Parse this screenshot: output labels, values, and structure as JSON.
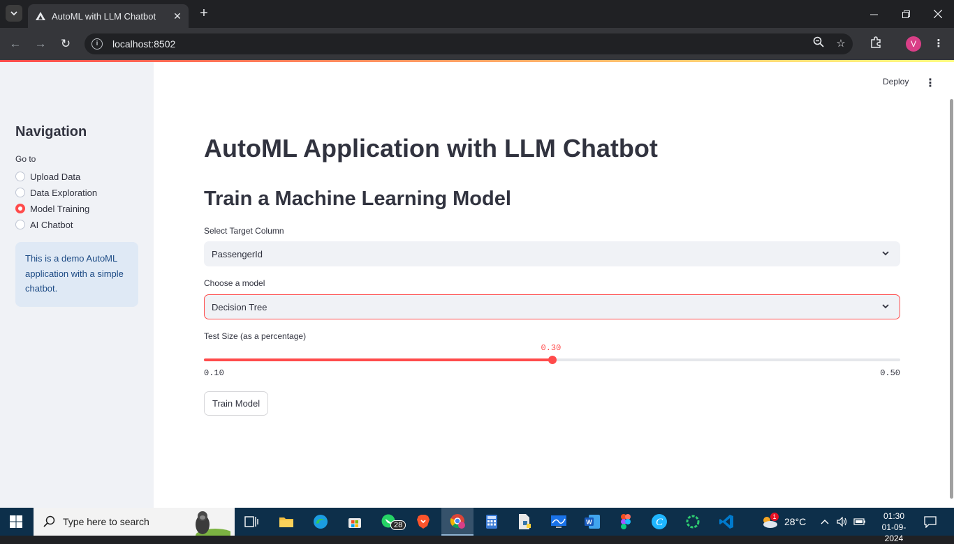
{
  "browser": {
    "tab_title": "AutoML with LLM Chatbot",
    "url": "localhost:8502",
    "profile_initial": "V"
  },
  "app": {
    "deploy_label": "Deploy",
    "sidebar": {
      "title": "Navigation",
      "goto_label": "Go to",
      "options": [
        {
          "label": "Upload Data",
          "checked": false
        },
        {
          "label": "Data Exploration",
          "checked": false
        },
        {
          "label": "Model Training",
          "checked": true
        },
        {
          "label": "AI Chatbot",
          "checked": false
        }
      ],
      "info": "This is a demo AutoML application with a simple chatbot."
    },
    "main": {
      "title": "AutoML Application with LLM Chatbot",
      "subtitle": "Train a Machine Learning Model",
      "target_label": "Select Target Column",
      "target_value": "PassengerId",
      "model_label": "Choose a model",
      "model_value": "Decision Tree",
      "slider_label": "Test Size (as a percentage)",
      "slider": {
        "value": 0.3,
        "value_label": "0.30",
        "min": 0.1,
        "min_label": "0.10",
        "max": 0.5,
        "max_label": "0.50"
      },
      "train_button": "Train Model"
    },
    "accent_color": "#ff4b4b"
  },
  "taskbar": {
    "search_placeholder": "Type here to search",
    "whatsapp_badge": "28",
    "weather_badge": "1",
    "temperature": "28°C",
    "time": "01:30",
    "date": "01-09-2024"
  }
}
